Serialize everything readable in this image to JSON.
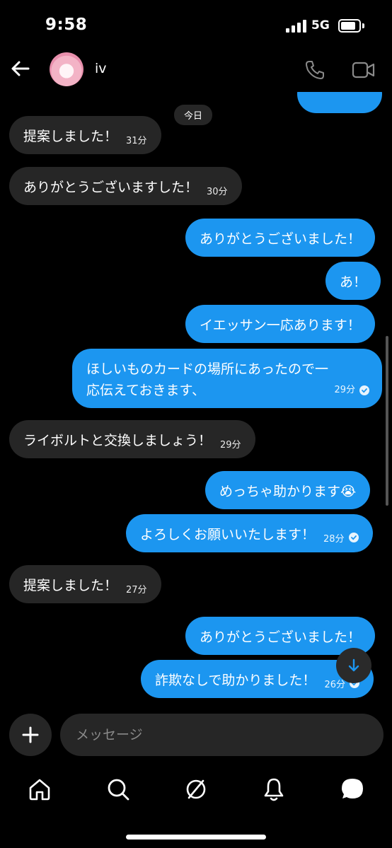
{
  "status_bar": {
    "time": "9:58",
    "network": "5G"
  },
  "header": {
    "contact_name": "iv"
  },
  "chat": {
    "date_label": "今日",
    "messages": [
      {
        "dir": "out",
        "text": "",
        "time": "31分"
      },
      {
        "dir": "in",
        "text": "提案しました！",
        "time": "31分"
      },
      {
        "dir": "in",
        "text": "ありがとうございますした！",
        "time": "30分"
      },
      {
        "dir": "out",
        "text": "ありがとうございました！",
        "time": ""
      },
      {
        "dir": "out",
        "text": "あ！",
        "time": ""
      },
      {
        "dir": "out",
        "text": "イエッサン一応あります！",
        "time": ""
      },
      {
        "dir": "out",
        "text": "ほしいものカードの場所にあったので一応伝えておきます、",
        "time": "29分"
      },
      {
        "dir": "in",
        "text": "ライボルトと交換しましょう！",
        "time": "29分"
      },
      {
        "dir": "out",
        "text": "めっちゃ助かります😭",
        "time": ""
      },
      {
        "dir": "out",
        "text": "よろしくお願いいたします！",
        "time": "28分"
      },
      {
        "dir": "in",
        "text": "提案しました！",
        "time": "27分"
      },
      {
        "dir": "out",
        "text": "ありがとうございました！",
        "time": ""
      },
      {
        "dir": "out",
        "text": "詐欺なしで助かりました！",
        "time": "26分"
      }
    ]
  },
  "composer": {
    "placeholder": "メッセージ"
  },
  "nav": {
    "icons": [
      "home-icon",
      "search-icon",
      "explore-icon",
      "notifications-icon",
      "messages-icon"
    ]
  },
  "colors": {
    "outgoing": "#1c96f0",
    "incoming": "#262626",
    "background": "#000000"
  }
}
